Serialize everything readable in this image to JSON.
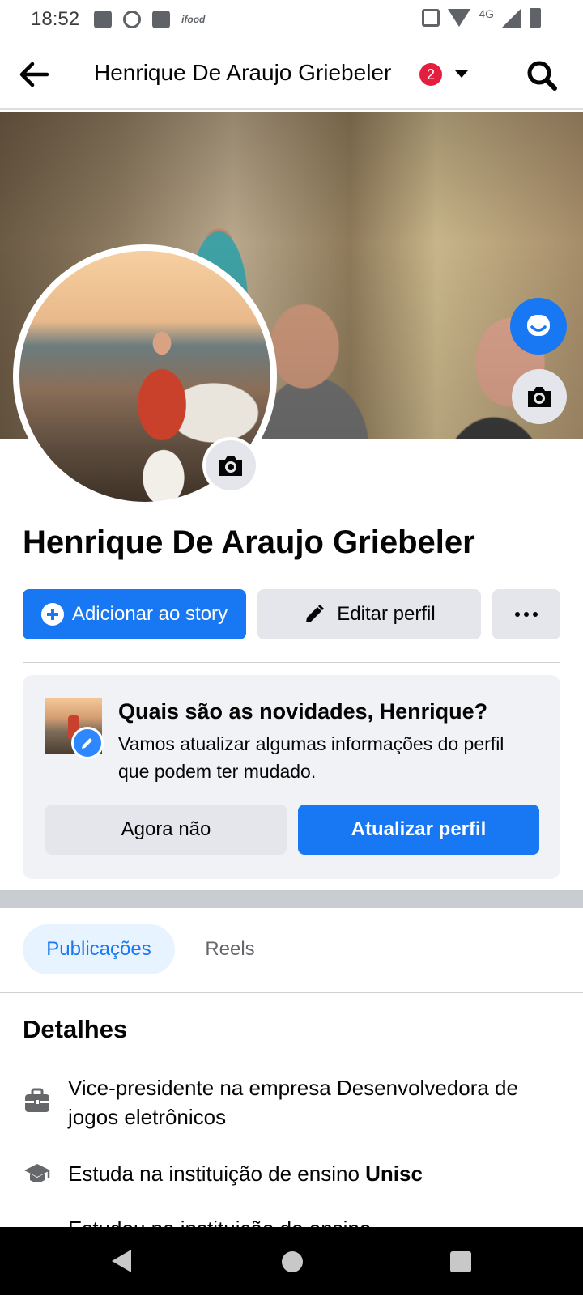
{
  "status_bar": {
    "time": "18:52",
    "network": "4G",
    "app_icons": [
      "gallery-icon",
      "whatsapp-icon",
      "game-icon",
      "ifood-icon"
    ],
    "ifood_label": "ifood"
  },
  "header": {
    "title": "Henrique De Araujo Griebeler",
    "notification_count": "2"
  },
  "profile": {
    "name": "Henrique De Araujo Griebeler"
  },
  "actions": {
    "add_story_label": "Adicionar ao story",
    "edit_profile_label": "Editar perfil"
  },
  "prompt": {
    "title": "Quais são as novidades, Henrique?",
    "body": "Vamos atualizar algumas informações do perfil que podem ter mudado.",
    "later_label": "Agora não",
    "update_label": "Atualizar perfil"
  },
  "tabs": [
    {
      "label": "Publicações",
      "active": true
    },
    {
      "label": "Reels",
      "active": false
    }
  ],
  "details": {
    "title": "Detalhes",
    "work": "Vice-presidente na empresa Desenvolvedora de jogos eletrônicos",
    "study_prefix": "Estuda na instituição de ensino ",
    "study_school": "Unisc",
    "study2_partial": "Estudou na instituição de ensino"
  },
  "colors": {
    "brand_blue": "#1877f2",
    "badge_red": "#e41e3f",
    "button_gray": "#e4e6eb",
    "card_bg": "#f0f2f5"
  }
}
